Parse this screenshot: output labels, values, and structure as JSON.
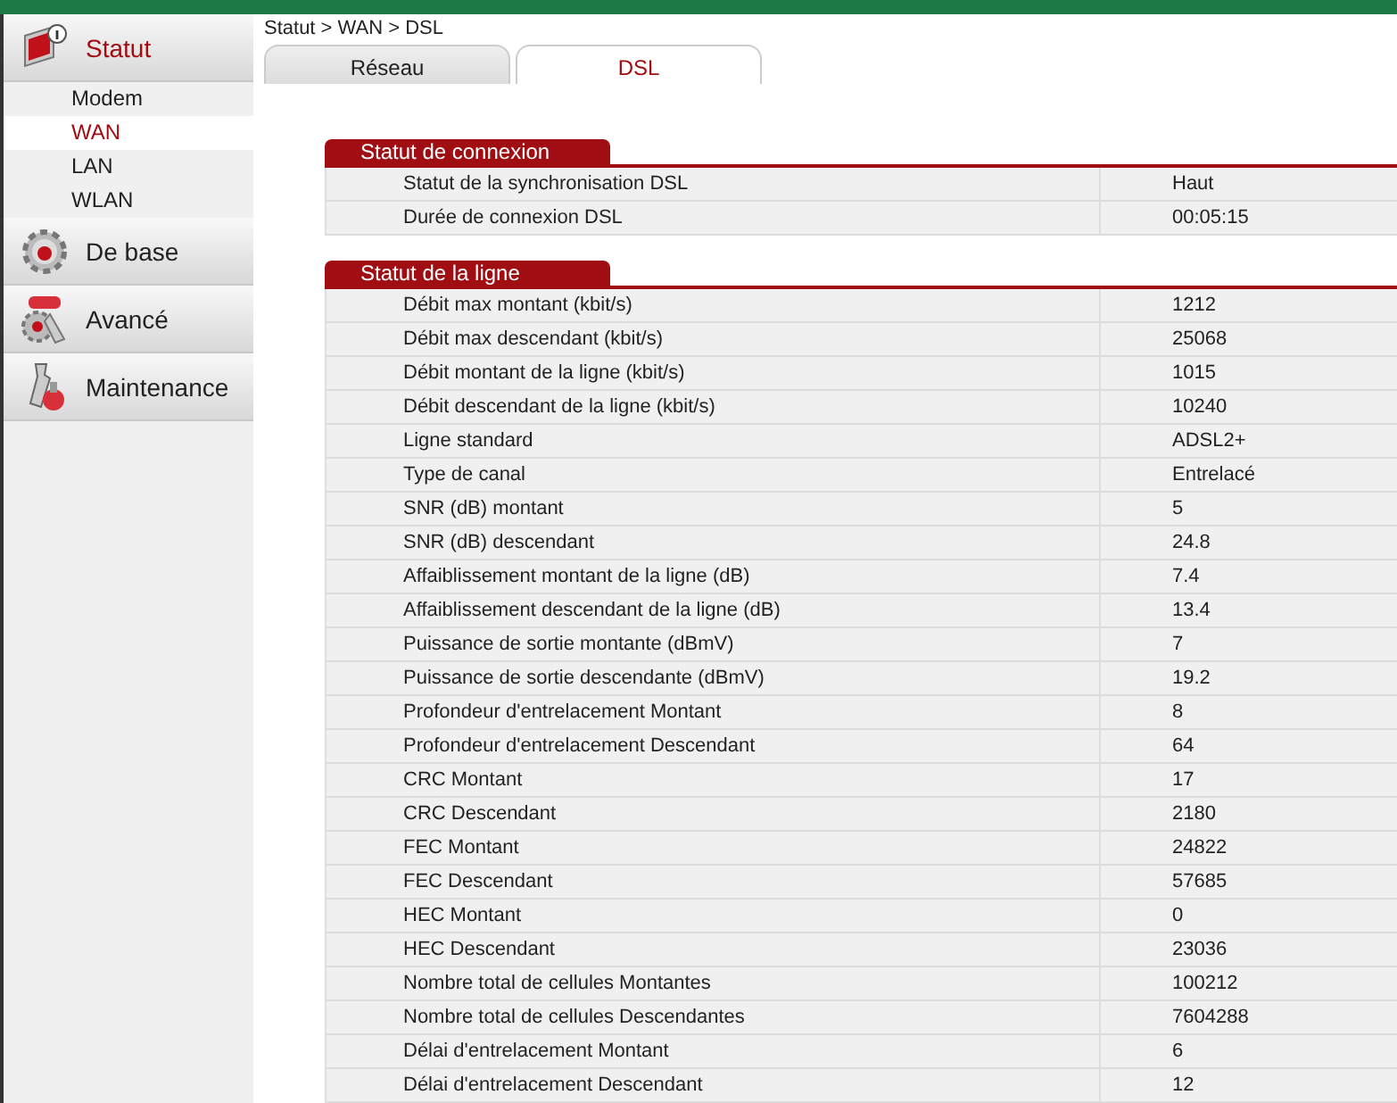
{
  "sidebar": {
    "groups": [
      {
        "label": "Statut",
        "selected": true,
        "items": [
          {
            "label": "Modem",
            "selected": false
          },
          {
            "label": "WAN",
            "selected": true
          },
          {
            "label": "LAN",
            "selected": false
          },
          {
            "label": "WLAN",
            "selected": false
          }
        ]
      },
      {
        "label": "De base",
        "selected": false
      },
      {
        "label": "Avancé",
        "selected": false
      },
      {
        "label": "Maintenance",
        "selected": false
      }
    ]
  },
  "breadcrumb": "Statut > WAN > DSL",
  "tabs": [
    {
      "label": "Réseau",
      "selected": false
    },
    {
      "label": "DSL",
      "selected": true
    }
  ],
  "sections": [
    {
      "title": "Statut de connexion",
      "rows": [
        [
          "Statut de la synchronisation DSL",
          "Haut"
        ],
        [
          "Durée de connexion DSL",
          "00:05:15"
        ]
      ]
    },
    {
      "title": "Statut de la ligne",
      "rows": [
        [
          "Débit max montant (kbit/s)",
          "1212"
        ],
        [
          "Débit max descendant (kbit/s)",
          "25068"
        ],
        [
          "Débit montant de la ligne (kbit/s)",
          "1015"
        ],
        [
          "Débit descendant de la ligne (kbit/s)",
          "10240"
        ],
        [
          "Ligne standard",
          "ADSL2+"
        ],
        [
          "Type de canal",
          "Entrelacé"
        ],
        [
          "SNR (dB) montant",
          "5"
        ],
        [
          "SNR (dB) descendant",
          "24.8"
        ],
        [
          "Affaiblissement montant de la ligne (dB)",
          "7.4"
        ],
        [
          "Affaiblissement descendant de la ligne (dB)",
          "13.4"
        ],
        [
          "Puissance de sortie montante (dBmV)",
          "7"
        ],
        [
          "Puissance de sortie descendante (dBmV)",
          "19.2"
        ],
        [
          "Profondeur d'entrelacement Montant",
          "8"
        ],
        [
          "Profondeur d'entrelacement Descendant",
          "64"
        ],
        [
          "CRC Montant",
          "17"
        ],
        [
          "CRC Descendant",
          "2180"
        ],
        [
          "FEC Montant",
          "24822"
        ],
        [
          "FEC Descendant",
          "57685"
        ],
        [
          "HEC Montant",
          "0"
        ],
        [
          "HEC Descendant",
          "23036"
        ],
        [
          "Nombre total de cellules Montantes",
          "100212"
        ],
        [
          "Nombre total de cellules Descendantes",
          "7604288"
        ],
        [
          "Délai d'entrelacement Montant",
          "6"
        ],
        [
          "Délai d'entrelacement Descendant",
          "12"
        ]
      ]
    }
  ]
}
